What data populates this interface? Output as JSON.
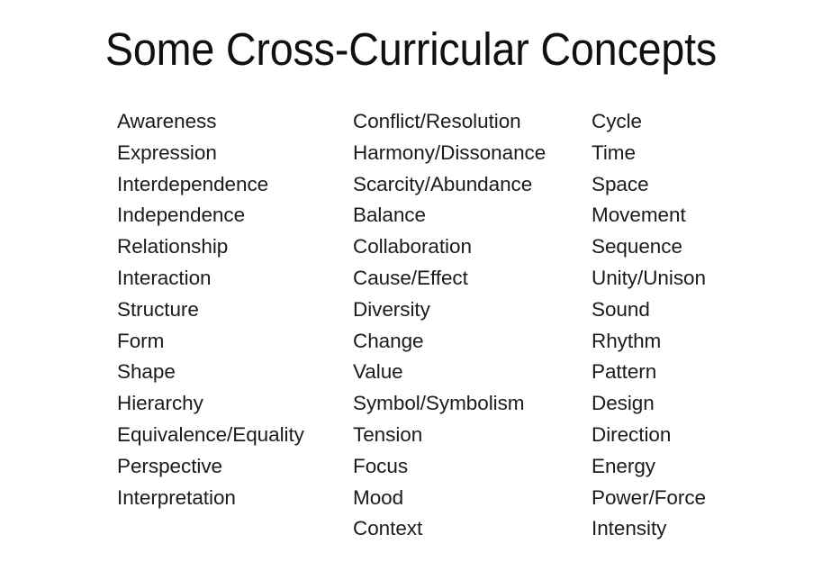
{
  "slide": {
    "title": "Some Cross-Curricular Concepts",
    "background_color": "#ffffff",
    "title_color": "#101010",
    "text_color": "#1b1b1b"
  },
  "columns": [
    {
      "name": "column-1",
      "items": [
        "Awareness",
        "Expression",
        "Interdependence",
        "Independence",
        "Relationship",
        "Interaction",
        "Structure",
        "Form",
        "Shape",
        "Hierarchy",
        "Equivalence/Equality",
        "Perspective",
        "Interpretation"
      ]
    },
    {
      "name": "column-2",
      "items": [
        "Conflict/Resolution",
        "Harmony/Dissonance",
        "Scarcity/Abundance",
        "Balance",
        "Collaboration",
        "Cause/Effect",
        "Diversity",
        "Change",
        "Value",
        "Symbol/Symbolism",
        "Tension",
        "Focus",
        "Mood",
        "Context"
      ]
    },
    {
      "name": "column-3",
      "items": [
        "Cycle",
        "Time",
        "Space",
        "Movement",
        "Sequence",
        "Unity/Unison",
        "Sound",
        "Rhythm",
        "Pattern",
        "Design",
        "Direction",
        "Energy",
        "Power/Force",
        "Intensity"
      ]
    }
  ]
}
